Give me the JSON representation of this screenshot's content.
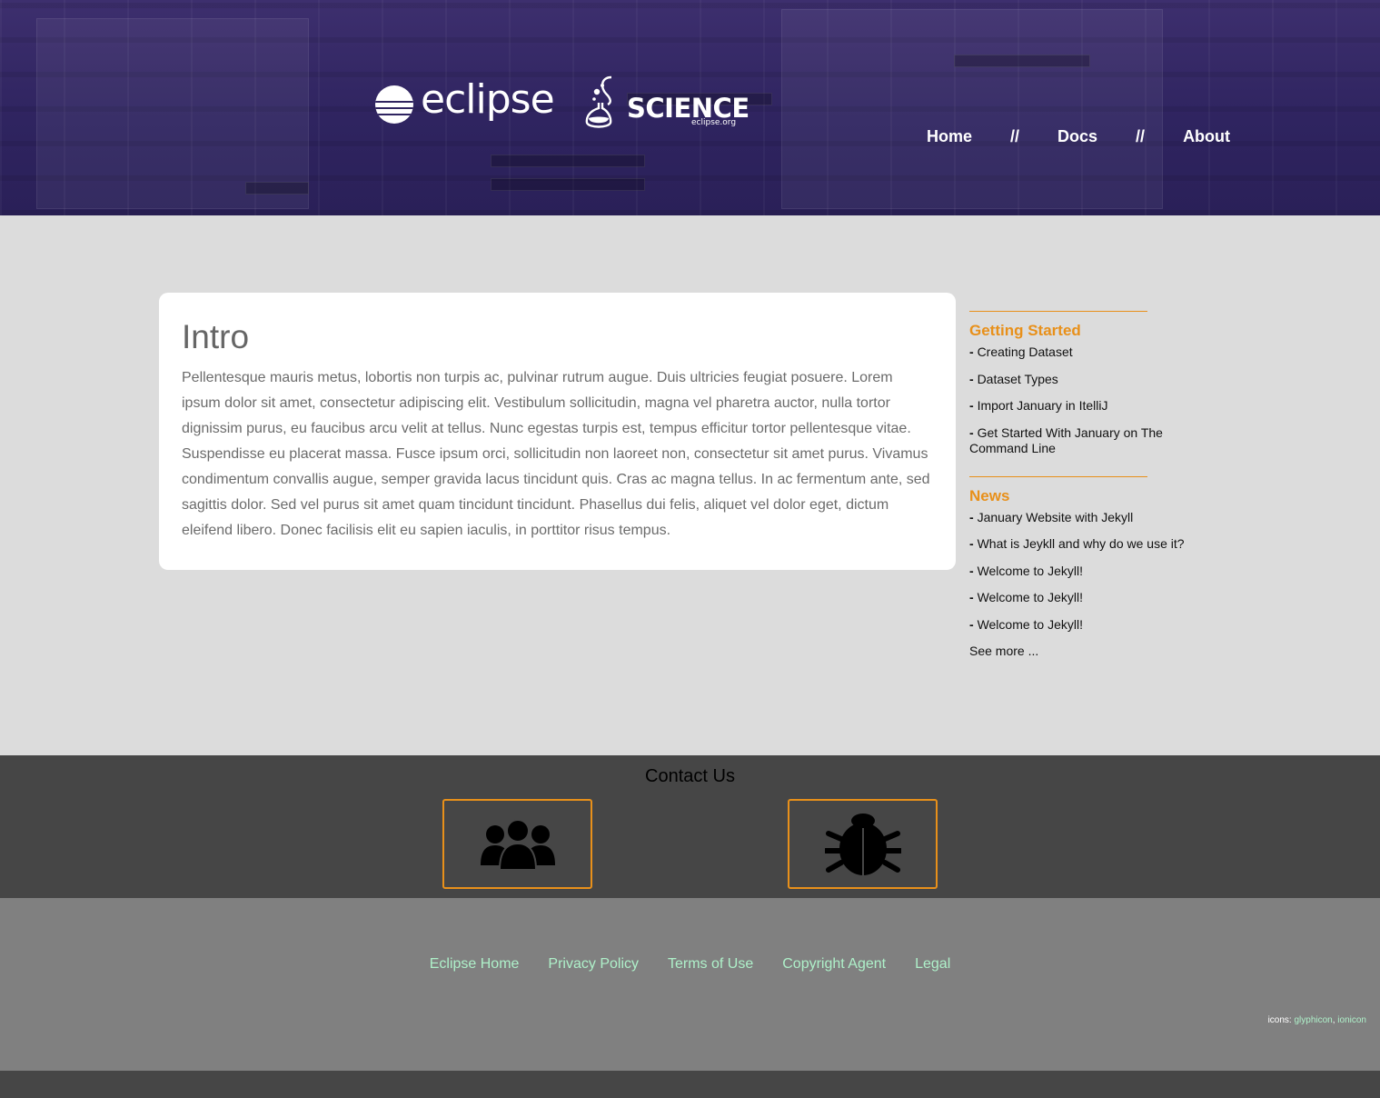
{
  "header": {
    "logo_eclipse_text": "eclipse",
    "logo_science_text": "SCIENCE",
    "logo_science_sub": "eclipse.org",
    "nav": [
      {
        "label": "Home"
      },
      {
        "label": "Docs"
      },
      {
        "label": "About"
      }
    ],
    "nav_separator": "//"
  },
  "intro": {
    "title": "Intro",
    "body": "Pellentesque mauris metus, lobortis non turpis ac, pulvinar rutrum augue. Duis ultricies feugiat posuere. Lorem ipsum dolor sit amet, consectetur adipiscing elit. Vestibulum sollicitudin, magna vel pharetra auctor, nulla tortor dignissim purus, eu faucibus arcu velit at tellus. Nunc egestas turpis est, tempus efficitur tortor pellentesque vitae. Suspendisse eu placerat massa. Fusce ipsum orci, sollicitudin non laoreet non, consectetur sit amet purus. Vivamus condimentum convallis augue, semper gravida lacus tincidunt quis. Cras ac magna tellus. In ac fermentum ante, sed sagittis dolor. Sed vel purus sit amet quam tincidunt tincidunt. Phasellus dui felis, aliquet vel dolor eget, dictum eleifend libero. Donec facilisis elit eu sapien iaculis, in porttitor risus tempus."
  },
  "sidebar": {
    "bullet": "-",
    "getting_started": {
      "title": "Getting Started",
      "items": [
        "Creating Dataset",
        "Dataset Types",
        "Import January in ItelliJ",
        "Get Started With January on The Command Line"
      ]
    },
    "news": {
      "title": "News",
      "items": [
        "January Website with Jekyll",
        "What is Jeykll and why do we use it?",
        "Welcome to Jekyll!",
        "Welcome to Jekyll!",
        "Welcome to Jekyll!"
      ],
      "see_more": "See more ..."
    }
  },
  "contact": {
    "title": "Contact Us",
    "buttons": [
      {
        "icon": "users-icon"
      },
      {
        "icon": "bug-icon"
      }
    ]
  },
  "footer": {
    "links": [
      "Eclipse Home",
      "Privacy Policy",
      "Terms of Use",
      "Copyright Agent",
      "Legal"
    ],
    "credits_label": "icons:",
    "credit_links": [
      "glyphicon",
      "ionicon"
    ],
    "credit_sep": ","
  },
  "colors": {
    "header_bg": "#2f2460",
    "accent": "#e8901a",
    "link": "#aef0c9",
    "page_bg": "#dcdcdc",
    "contact_bg": "#464646",
    "footer_bg": "#808080"
  }
}
